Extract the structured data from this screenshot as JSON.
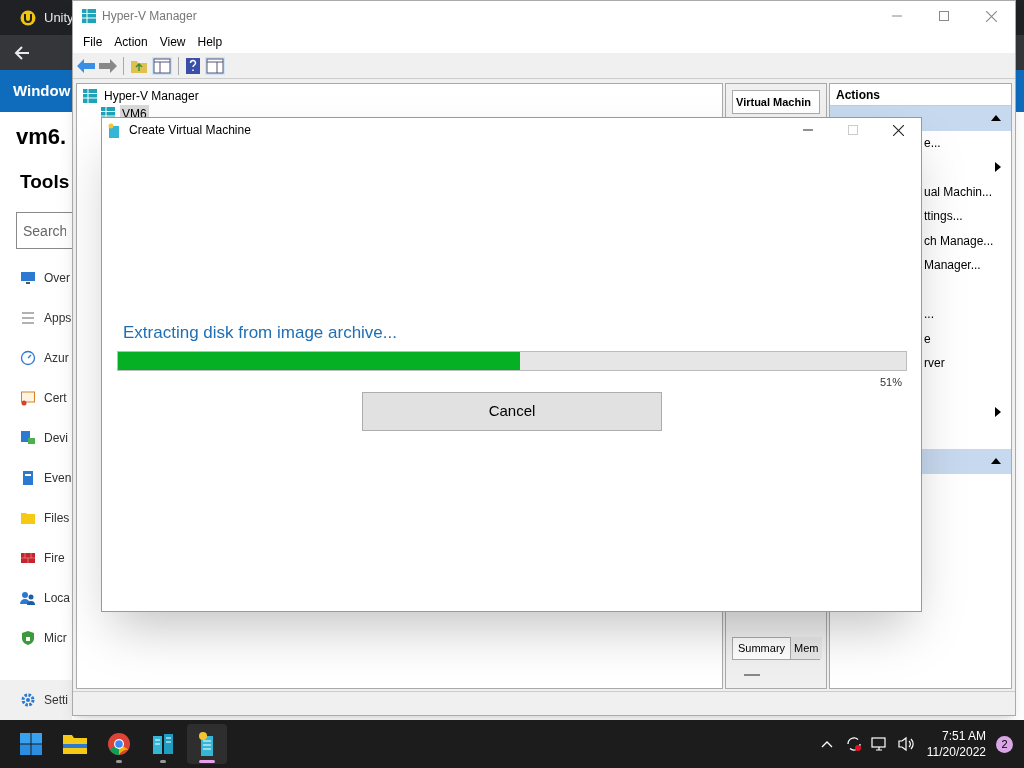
{
  "browser": {
    "tab_title": "Unity",
    "banner": "Window",
    "heading": "vm6.",
    "section": "Tools",
    "search": {
      "placeholder": "Search"
    },
    "tools": [
      {
        "kind": "monitor",
        "label": "Over",
        "selected": false
      },
      {
        "kind": "list",
        "label": "Apps",
        "selected": false
      },
      {
        "kind": "gauge",
        "label": "Azur",
        "selected": false
      },
      {
        "kind": "certificate",
        "label": "Cert",
        "selected": false
      },
      {
        "kind": "devices",
        "label": "Devi",
        "selected": false
      },
      {
        "kind": "log",
        "label": "Even",
        "selected": false
      },
      {
        "kind": "folder",
        "label": "Files",
        "selected": false
      },
      {
        "kind": "firewall",
        "label": "Fire",
        "selected": false
      },
      {
        "kind": "users",
        "label": "Loca",
        "selected": false
      },
      {
        "kind": "shield",
        "label": "Micr",
        "selected": false
      }
    ],
    "settings": {
      "label": "Setti",
      "selected": true
    }
  },
  "hyperv": {
    "title": "Hyper-V Manager",
    "menu": [
      "File",
      "Action",
      "View",
      "Help"
    ],
    "tree": [
      {
        "label": "Hyper-V Manager",
        "selected": false,
        "children": [
          {
            "label": "VM6",
            "selected": true
          }
        ]
      }
    ],
    "middle": {
      "header": "Virtual Machin",
      "tabs": [
        {
          "label": "Summary",
          "selected": true
        },
        {
          "label": "Mem",
          "selected": false
        }
      ]
    },
    "actions": {
      "title": "Actions",
      "rows": [
        {
          "kind": "header",
          "expanded": true
        },
        {
          "kind": "item",
          "label": "e..."
        },
        {
          "kind": "submenu"
        },
        {
          "kind": "item",
          "label": "ual Machin..."
        },
        {
          "kind": "item",
          "label": "ttings..."
        },
        {
          "kind": "item",
          "label": "ch Manage..."
        },
        {
          "kind": "item",
          "label": "Manager..."
        },
        {
          "kind": "blank"
        },
        {
          "kind": "item",
          "label": "..."
        },
        {
          "kind": "item",
          "label": "e"
        },
        {
          "kind": "item",
          "label": "rver"
        },
        {
          "kind": "blank"
        },
        {
          "kind": "submenu"
        },
        {
          "kind": "blank"
        },
        {
          "kind": "header",
          "expanded": true
        },
        {
          "kind": "blank"
        },
        {
          "kind": "blank"
        }
      ]
    }
  },
  "dialog": {
    "title": "Create Virtual Machine",
    "message": "Extracting disk from image archive...",
    "progress": {
      "level": 0.51,
      "reading": "51%"
    },
    "button": "Cancel"
  },
  "taskbar": {
    "apps": [
      {
        "kind": "start",
        "running": false,
        "active": false
      },
      {
        "kind": "folder",
        "running": false,
        "active": false
      },
      {
        "kind": "chrome",
        "running": true,
        "active": false
      },
      {
        "kind": "servers",
        "running": true,
        "active": false
      },
      {
        "kind": "wizard",
        "running": true,
        "active": true
      }
    ],
    "time": "7:51 AM",
    "date": "11/20/2022",
    "notifications": "2"
  }
}
